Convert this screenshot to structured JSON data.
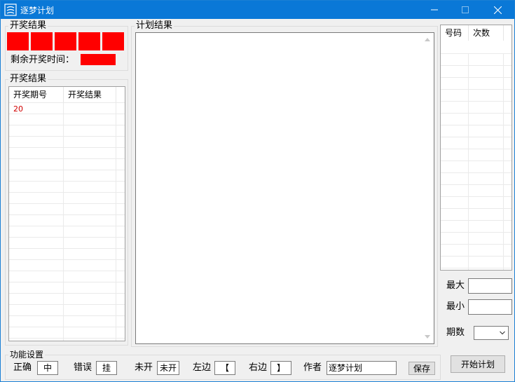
{
  "window": {
    "title": "逐梦计划"
  },
  "lottery_group": {
    "title": "开奖结果"
  },
  "remaining_time_label": "剩余开奖时间：",
  "results_group": {
    "title": "开奖结果",
    "columns": [
      "开奖期号",
      "开奖结果"
    ],
    "rows": [
      {
        "period": "20",
        "result": ""
      }
    ]
  },
  "plan_group": {
    "title": "计划结果",
    "content": ""
  },
  "stats": {
    "columns": [
      "号码",
      "次数"
    ]
  },
  "max_label": "最大",
  "min_label": "最小",
  "periods_label": "期数",
  "func_group": {
    "title": "功能设置"
  },
  "settings": {
    "correct_label": "正确",
    "correct_value": "中",
    "wrong_label": "错误",
    "wrong_value": "挂",
    "unopened_label": "未开",
    "unopened_value": "未开",
    "left_label": "左边",
    "left_value": "【",
    "right_label": "右边",
    "right_value": "】",
    "author_label": "作者",
    "author_value": "逐梦计划"
  },
  "buttons": {
    "save": "保存",
    "start": "开始计划"
  },
  "colors": {
    "titlebar": "#0a78d7",
    "indicator": "#ff0000",
    "period_text": "#d00000"
  }
}
